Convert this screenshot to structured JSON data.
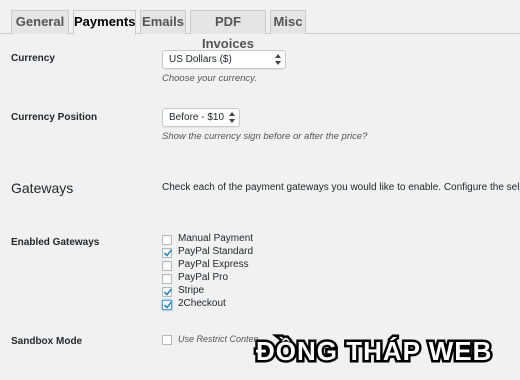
{
  "tabs": [
    {
      "label": "General",
      "active": false
    },
    {
      "label": "Payments",
      "active": true
    },
    {
      "label": "Emails",
      "active": false
    },
    {
      "label": "PDF Invoices",
      "active": false
    },
    {
      "label": "Misc",
      "active": false
    }
  ],
  "currency": {
    "label": "Currency",
    "value": "US Dollars ($)",
    "description": "Choose your currency."
  },
  "currency_position": {
    "label": "Currency Position",
    "value": "Before - $10",
    "description": "Show the currency sign before or after the price?"
  },
  "gateways": {
    "heading": "Gateways",
    "intro": "Check each of the payment gateways you would like to enable. Configure the sel"
  },
  "enabled_gateways": {
    "label": "Enabled Gateways",
    "items": [
      {
        "label": "Manual Payment",
        "checked": false
      },
      {
        "label": "PayPal Standard",
        "checked": true
      },
      {
        "label": "PayPal Express",
        "checked": false
      },
      {
        "label": "PayPal Pro",
        "checked": false
      },
      {
        "label": "Stripe",
        "checked": true
      },
      {
        "label": "2Checkout",
        "checked": true
      }
    ]
  },
  "sandbox": {
    "label": "Sandbox Mode",
    "description": "Use Restrict Conten",
    "checked": false
  },
  "watermark": {
    "text": "ĐỒNG THÁP WEB"
  },
  "colors": {
    "check": "#1e8cbe",
    "focus": "#5b9dd9"
  }
}
